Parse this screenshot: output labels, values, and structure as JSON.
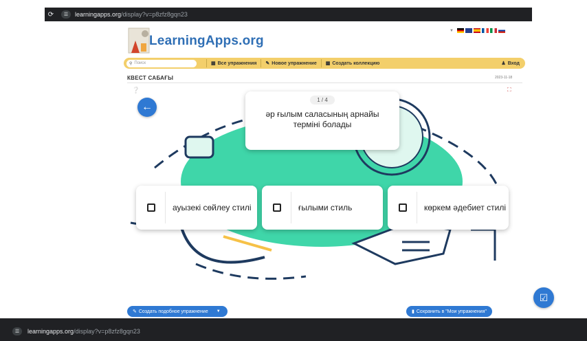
{
  "browser_top": {
    "url_host": "learningapps.org",
    "url_path": "/display?v=p8zfz8gqn23"
  },
  "browser_bottom": {
    "url_host": "learningapps.org",
    "url_path": "/display?v=p8zfz8gqn23"
  },
  "header": {
    "logo_text": "LearningApps.org"
  },
  "nav": {
    "search_placeholder": "Поиск",
    "all_exercises": "Все упражнения",
    "new_exercise": "Новое упражнение",
    "create_collection": "Создать коллекцию",
    "login": "Вход"
  },
  "page": {
    "title": "КВЕСТ САБАҒЫ",
    "date": "2023-11-18"
  },
  "quiz": {
    "counter": "1 / 4",
    "question": "әр ғылым саласының арнайы терміні болады",
    "answers": [
      {
        "text": "ауызекі сөйлеу стилі"
      },
      {
        "text": "ғылыми стиль"
      },
      {
        "text": "көркем әдебиет стилі"
      }
    ]
  },
  "footer": {
    "create_similar": "Создать подобное упражнение",
    "save_mine": "Сохранить в \"Мои упражнения\""
  },
  "colors": {
    "accent": "#2f79d3",
    "nav_bg": "#f3cf6b",
    "illustration": "#3fd6a9"
  },
  "icons": [
    "reload-icon",
    "site-settings-icon",
    "search-icon",
    "grid-icon",
    "pencil-icon",
    "collection-icon",
    "user-icon",
    "back-arrow-icon",
    "fullscreen-icon",
    "check-icon",
    "edit-icon",
    "bookmark-icon"
  ]
}
